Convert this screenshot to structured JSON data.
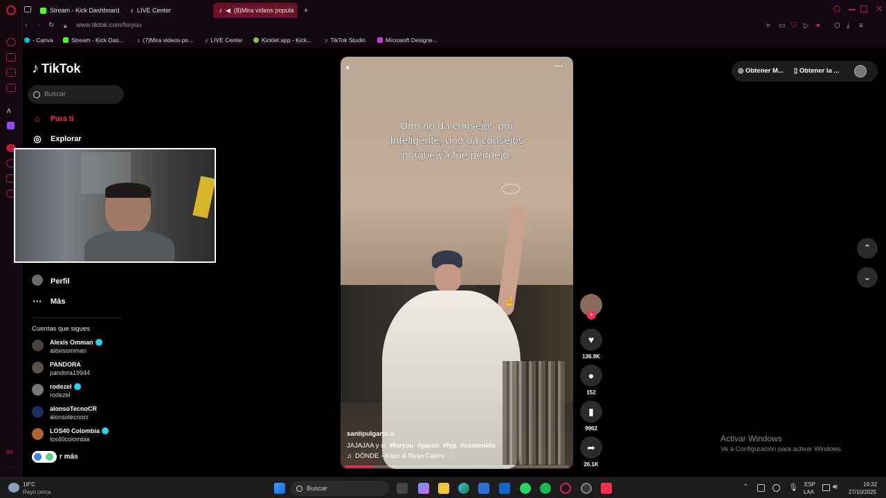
{
  "browser": {
    "tabs": [
      {
        "label": "Stream - Kick Dashboard",
        "color": "#53fc18"
      },
      {
        "label": "LIVE Center",
        "color": "#ffffff"
      },
      {
        "label": "(8)Mira videos popula",
        "color": "#ffffff",
        "active": true
      }
    ],
    "url": "www.tiktok.com/foryou",
    "bookmarks": [
      {
        "label": "- Canva",
        "color": "#00c4cc"
      },
      {
        "label": "Stream - Kick Das...",
        "color": "#53fc18"
      },
      {
        "label": "(7)Mira videos po...",
        "color": "#ffffff"
      },
      {
        "label": "LIVE Center",
        "color": "#ffffff"
      },
      {
        "label": "Kicklet.app - Kick...",
        "color": "#8bc34a"
      },
      {
        "label": "TikTok Studio",
        "color": "#ffffff"
      },
      {
        "label": "Microsoft Designe...",
        "color": "#c73ae0"
      }
    ]
  },
  "tiktok": {
    "logo": "TikTok",
    "search_placeholder": "Buscar",
    "nav": [
      {
        "label": "Para ti",
        "icon": "home-icon",
        "active": true
      },
      {
        "label": "Explorar",
        "icon": "compass-icon"
      },
      {
        "label": "Perfil",
        "icon": "avatar"
      },
      {
        "label": "Más",
        "icon": "more-icon"
      }
    ],
    "following_title": "Cuentas que sigues",
    "following": [
      {
        "name": "Alexis Omman",
        "user": "alexisomman",
        "verified": true
      },
      {
        "name": "PANDORA",
        "user": "pandora19944",
        "verified": false
      },
      {
        "name": "rodezel",
        "user": "rodezel",
        "verified": true
      },
      {
        "name": "alonsoTecnoCR",
        "user": "alonsotecnocr",
        "verified": false
      },
      {
        "name": "LOS40 Colombia",
        "user": "los40colombia",
        "verified": true
      }
    ],
    "see_more": "r más",
    "video": {
      "caption_lines": [
        "Uno no da consejos por",
        "Inteligente, uno da consejos",
        "porque ya fue pendejo."
      ],
      "author": "santipulgarin.o",
      "description": "JAJAJAA y si",
      "hashtags": [
        "#foryou",
        "#parati",
        "#fyp",
        "#contenido"
      ],
      "music": "DÓNDE - Kapo & Ryan Castro",
      "progress": 0.13
    },
    "actions": {
      "likes": "136.9K",
      "comments": "152",
      "saves": "9962",
      "shares": "26.1K"
    },
    "top_right": {
      "item1": "Obtener M...",
      "item2": "Obtener la ..."
    }
  },
  "activate_windows": {
    "title": "Activar Windows",
    "subtitle": "Ve a Configuración para activar Windows."
  },
  "taskbar": {
    "weather_temp": "18°C",
    "weather_desc": "Rayo cerca",
    "search": "Buscar",
    "lang1": "ESP",
    "lang2": "LAA",
    "time": "19:32",
    "date": "27/10/2025"
  }
}
